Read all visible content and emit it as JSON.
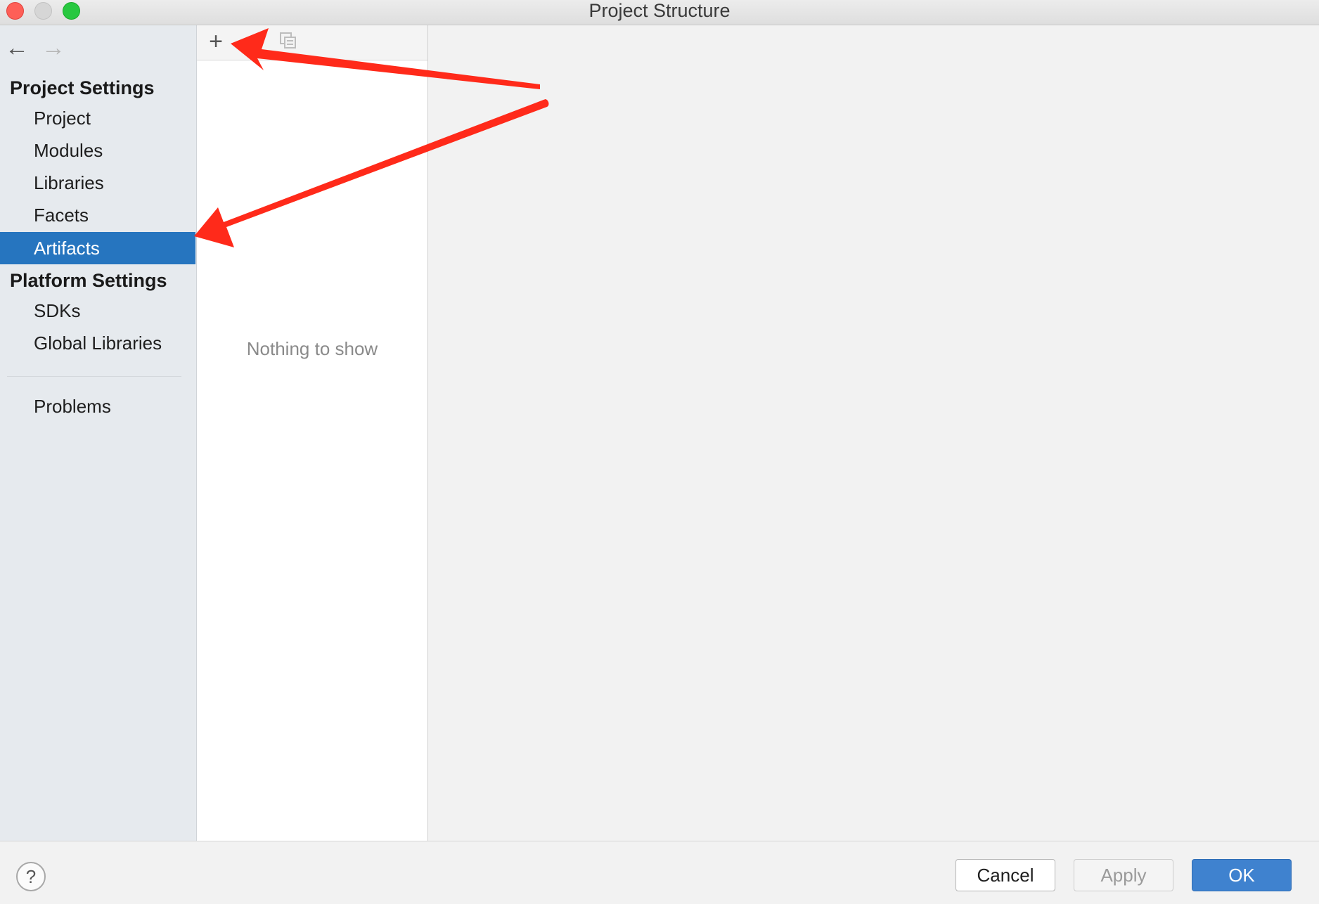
{
  "window": {
    "title": "Project Structure"
  },
  "navigation": {
    "back_icon": "←",
    "forward_icon": "→"
  },
  "sidebar": {
    "project_settings_header": "Project Settings",
    "project_items": [
      {
        "label": "Project"
      },
      {
        "label": "Modules"
      },
      {
        "label": "Libraries"
      },
      {
        "label": "Facets"
      },
      {
        "label": "Artifacts",
        "selected": true
      }
    ],
    "platform_settings_header": "Platform Settings",
    "platform_items": [
      {
        "label": "SDKs"
      },
      {
        "label": "Global Libraries"
      }
    ],
    "problems_label": "Problems"
  },
  "list_panel": {
    "add_icon": "+",
    "copy_icon": "copy-icon",
    "empty_message": "Nothing to show"
  },
  "footer": {
    "help_icon": "?",
    "cancel_label": "Cancel",
    "apply_label": "Apply",
    "ok_label": "OK"
  },
  "colors": {
    "selection": "#2675bf",
    "annotation_arrow": "#ff2a1a",
    "ok_button": "#3f82cf"
  }
}
